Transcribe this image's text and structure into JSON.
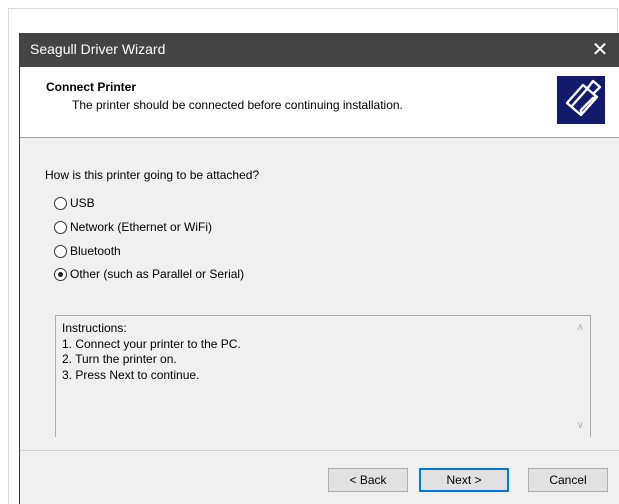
{
  "window": {
    "title": "Seagull Driver Wizard",
    "close_glyph": "✕"
  },
  "header": {
    "title": "Connect Printer",
    "subtitle": "The printer should be connected before continuing installation.",
    "logo_icon": "printer-icon"
  },
  "form": {
    "question": "How is this printer going to be attached?",
    "options": [
      {
        "label": "USB",
        "checked": false
      },
      {
        "label": "Network (Ethernet or WiFi)",
        "checked": false
      },
      {
        "label": "Bluetooth",
        "checked": false
      },
      {
        "label": "Other (such as Parallel or Serial)",
        "checked": true
      }
    ]
  },
  "instructions": {
    "lines": [
      "Instructions:",
      "1. Connect your printer to the PC.",
      "2. Turn the printer on.",
      "3. Press Next to continue."
    ]
  },
  "buttons": {
    "back": "< Back",
    "next": "Next >",
    "cancel": "Cancel"
  },
  "colors": {
    "titlebar": "#444444",
    "logo_bg": "#121a6b",
    "default_button_border": "#0078d7"
  }
}
